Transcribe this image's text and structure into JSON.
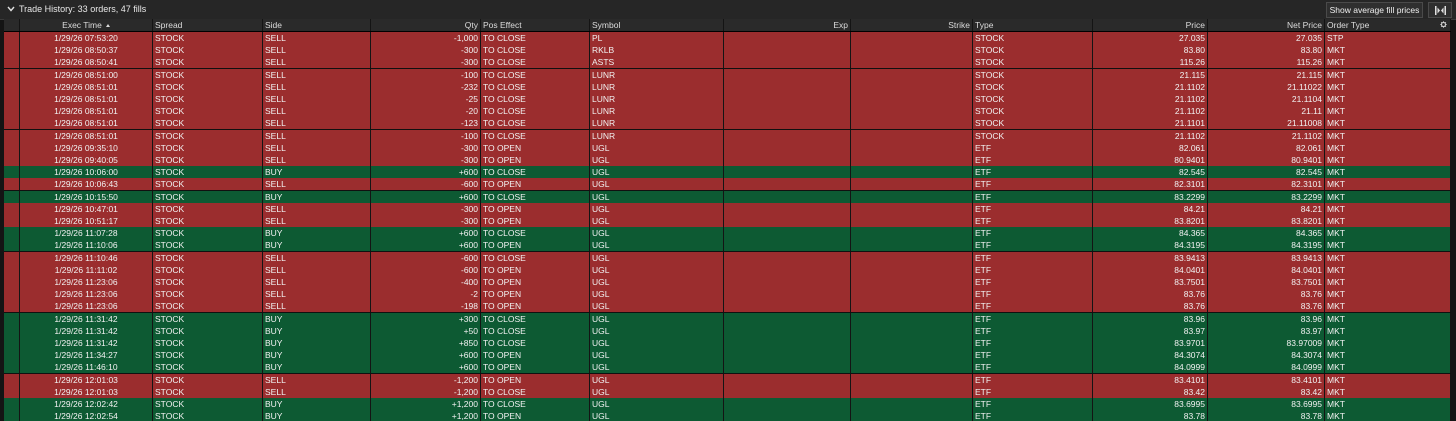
{
  "titlebar": {
    "title": "Trade History: 33 orders, 47 fills",
    "avg_button_label": "Show average fill prices"
  },
  "columns": [
    {
      "key": "exec_time",
      "label": "Exec Time",
      "align": "c",
      "sort": "asc"
    },
    {
      "key": "spread",
      "label": "Spread",
      "align": "l"
    },
    {
      "key": "side",
      "label": "Side",
      "align": "l"
    },
    {
      "key": "qty",
      "label": "Qty",
      "align": "r"
    },
    {
      "key": "pos_effect",
      "label": "Pos Effect",
      "align": "l"
    },
    {
      "key": "symbol",
      "label": "Symbol",
      "align": "l"
    },
    {
      "key": "exp",
      "label": "Exp",
      "align": "r"
    },
    {
      "key": "strike",
      "label": "Strike",
      "align": "r"
    },
    {
      "key": "type",
      "label": "Type",
      "align": "l"
    },
    {
      "key": "price",
      "label": "Price",
      "align": "r"
    },
    {
      "key": "net_price",
      "label": "Net Price",
      "align": "r"
    },
    {
      "key": "order_type",
      "label": "Order Type",
      "align": "l"
    }
  ],
  "rows": [
    {
      "exec_time": "1/29/26 07:53:20",
      "spread": "STOCK",
      "side": "SELL",
      "qty": "-1,000",
      "pos_effect": "TO CLOSE",
      "symbol": "PL",
      "exp": "",
      "strike": "",
      "type": "STOCK",
      "price": "27.035",
      "net_price": "27.035",
      "order_type": "STP"
    },
    {
      "exec_time": "1/29/26 08:50:37",
      "spread": "STOCK",
      "side": "SELL",
      "qty": "-300",
      "pos_effect": "TO CLOSE",
      "symbol": "RKLB",
      "exp": "",
      "strike": "",
      "type": "STOCK",
      "price": "83.80",
      "net_price": "83.80",
      "order_type": "MKT"
    },
    {
      "exec_time": "1/29/26 08:50:41",
      "spread": "STOCK",
      "side": "SELL",
      "qty": "-300",
      "pos_effect": "TO CLOSE",
      "symbol": "ASTS",
      "exp": "",
      "strike": "",
      "type": "STOCK",
      "price": "115.26",
      "net_price": "115.26",
      "order_type": "MKT"
    },
    {
      "exec_time": "1/29/26 08:51:00",
      "spread": "STOCK",
      "side": "SELL",
      "qty": "-100",
      "pos_effect": "TO CLOSE",
      "symbol": "LUNR",
      "exp": "",
      "strike": "",
      "type": "STOCK",
      "price": "21.115",
      "net_price": "21.115",
      "order_type": "MKT"
    },
    {
      "exec_time": "1/29/26 08:51:01",
      "spread": "STOCK",
      "side": "SELL",
      "qty": "-232",
      "pos_effect": "TO CLOSE",
      "symbol": "LUNR",
      "exp": "",
      "strike": "",
      "type": "STOCK",
      "price": "21.1102",
      "net_price": "21.11022",
      "order_type": "MKT"
    },
    {
      "exec_time": "1/29/26 08:51:01",
      "spread": "STOCK",
      "side": "SELL",
      "qty": "-25",
      "pos_effect": "TO CLOSE",
      "symbol": "LUNR",
      "exp": "",
      "strike": "",
      "type": "STOCK",
      "price": "21.1102",
      "net_price": "21.1104",
      "order_type": "MKT"
    },
    {
      "exec_time": "1/29/26 08:51:01",
      "spread": "STOCK",
      "side": "SELL",
      "qty": "-20",
      "pos_effect": "TO CLOSE",
      "symbol": "LUNR",
      "exp": "",
      "strike": "",
      "type": "STOCK",
      "price": "21.1102",
      "net_price": "21.11",
      "order_type": "MKT"
    },
    {
      "exec_time": "1/29/26 08:51:01",
      "spread": "STOCK",
      "side": "SELL",
      "qty": "-123",
      "pos_effect": "TO CLOSE",
      "symbol": "LUNR",
      "exp": "",
      "strike": "",
      "type": "STOCK",
      "price": "21.1101",
      "net_price": "21.11008",
      "order_type": "MKT"
    },
    {
      "exec_time": "1/29/26 08:51:01",
      "spread": "STOCK",
      "side": "SELL",
      "qty": "-100",
      "pos_effect": "TO CLOSE",
      "symbol": "LUNR",
      "exp": "",
      "strike": "",
      "type": "STOCK",
      "price": "21.1102",
      "net_price": "21.1102",
      "order_type": "MKT"
    },
    {
      "exec_time": "1/29/26 09:35:10",
      "spread": "STOCK",
      "side": "SELL",
      "qty": "-300",
      "pos_effect": "TO OPEN",
      "symbol": "UGL",
      "exp": "",
      "strike": "",
      "type": "ETF",
      "price": "82.061",
      "net_price": "82.061",
      "order_type": "MKT"
    },
    {
      "exec_time": "1/29/26 09:40:05",
      "spread": "STOCK",
      "side": "SELL",
      "qty": "-300",
      "pos_effect": "TO OPEN",
      "symbol": "UGL",
      "exp": "",
      "strike": "",
      "type": "ETF",
      "price": "80.9401",
      "net_price": "80.9401",
      "order_type": "MKT"
    },
    {
      "exec_time": "1/29/26 10:06:00",
      "spread": "STOCK",
      "side": "BUY",
      "qty": "+600",
      "pos_effect": "TO CLOSE",
      "symbol": "UGL",
      "exp": "",
      "strike": "",
      "type": "ETF",
      "price": "82.545",
      "net_price": "82.545",
      "order_type": "MKT"
    },
    {
      "exec_time": "1/29/26 10:06:43",
      "spread": "STOCK",
      "side": "SELL",
      "qty": "-600",
      "pos_effect": "TO OPEN",
      "symbol": "UGL",
      "exp": "",
      "strike": "",
      "type": "ETF",
      "price": "82.3101",
      "net_price": "82.3101",
      "order_type": "MKT"
    },
    {
      "exec_time": "1/29/26 10:15:50",
      "spread": "STOCK",
      "side": "BUY",
      "qty": "+600",
      "pos_effect": "TO CLOSE",
      "symbol": "UGL",
      "exp": "",
      "strike": "",
      "type": "ETF",
      "price": "83.2299",
      "net_price": "83.2299",
      "order_type": "MKT"
    },
    {
      "exec_time": "1/29/26 10:47:01",
      "spread": "STOCK",
      "side": "SELL",
      "qty": "-300",
      "pos_effect": "TO OPEN",
      "symbol": "UGL",
      "exp": "",
      "strike": "",
      "type": "ETF",
      "price": "84.21",
      "net_price": "84.21",
      "order_type": "MKT"
    },
    {
      "exec_time": "1/29/26 10:51:17",
      "spread": "STOCK",
      "side": "SELL",
      "qty": "-300",
      "pos_effect": "TO OPEN",
      "symbol": "UGL",
      "exp": "",
      "strike": "",
      "type": "ETF",
      "price": "83.8201",
      "net_price": "83.8201",
      "order_type": "MKT"
    },
    {
      "exec_time": "1/29/26 11:07:28",
      "spread": "STOCK",
      "side": "BUY",
      "qty": "+600",
      "pos_effect": "TO CLOSE",
      "symbol": "UGL",
      "exp": "",
      "strike": "",
      "type": "ETF",
      "price": "84.365",
      "net_price": "84.365",
      "order_type": "MKT"
    },
    {
      "exec_time": "1/29/26 11:10:06",
      "spread": "STOCK",
      "side": "BUY",
      "qty": "+600",
      "pos_effect": "TO OPEN",
      "symbol": "UGL",
      "exp": "",
      "strike": "",
      "type": "ETF",
      "price": "84.3195",
      "net_price": "84.3195",
      "order_type": "MKT"
    },
    {
      "exec_time": "1/29/26 11:10:46",
      "spread": "STOCK",
      "side": "SELL",
      "qty": "-600",
      "pos_effect": "TO CLOSE",
      "symbol": "UGL",
      "exp": "",
      "strike": "",
      "type": "ETF",
      "price": "83.9413",
      "net_price": "83.9413",
      "order_type": "MKT"
    },
    {
      "exec_time": "1/29/26 11:11:02",
      "spread": "STOCK",
      "side": "SELL",
      "qty": "-600",
      "pos_effect": "TO OPEN",
      "symbol": "UGL",
      "exp": "",
      "strike": "",
      "type": "ETF",
      "price": "84.0401",
      "net_price": "84.0401",
      "order_type": "MKT"
    },
    {
      "exec_time": "1/29/26 11:23:06",
      "spread": "STOCK",
      "side": "SELL",
      "qty": "-400",
      "pos_effect": "TO OPEN",
      "symbol": "UGL",
      "exp": "",
      "strike": "",
      "type": "ETF",
      "price": "83.7501",
      "net_price": "83.7501",
      "order_type": "MKT"
    },
    {
      "exec_time": "1/29/26 11:23:06",
      "spread": "STOCK",
      "side": "SELL",
      "qty": "-2",
      "pos_effect": "TO OPEN",
      "symbol": "UGL",
      "exp": "",
      "strike": "",
      "type": "ETF",
      "price": "83.76",
      "net_price": "83.76",
      "order_type": "MKT"
    },
    {
      "exec_time": "1/29/26 11:23:06",
      "spread": "STOCK",
      "side": "SELL",
      "qty": "-198",
      "pos_effect": "TO OPEN",
      "symbol": "UGL",
      "exp": "",
      "strike": "",
      "type": "ETF",
      "price": "83.76",
      "net_price": "83.76",
      "order_type": "MKT"
    },
    {
      "exec_time": "1/29/26 11:31:42",
      "spread": "STOCK",
      "side": "BUY",
      "qty": "+300",
      "pos_effect": "TO CLOSE",
      "symbol": "UGL",
      "exp": "",
      "strike": "",
      "type": "ETF",
      "price": "83.96",
      "net_price": "83.96",
      "order_type": "MKT"
    },
    {
      "exec_time": "1/29/26 11:31:42",
      "spread": "STOCK",
      "side": "BUY",
      "qty": "+50",
      "pos_effect": "TO CLOSE",
      "symbol": "UGL",
      "exp": "",
      "strike": "",
      "type": "ETF",
      "price": "83.97",
      "net_price": "83.97",
      "order_type": "MKT"
    },
    {
      "exec_time": "1/29/26 11:31:42",
      "spread": "STOCK",
      "side": "BUY",
      "qty": "+850",
      "pos_effect": "TO CLOSE",
      "symbol": "UGL",
      "exp": "",
      "strike": "",
      "type": "ETF",
      "price": "83.9701",
      "net_price": "83.97009",
      "order_type": "MKT"
    },
    {
      "exec_time": "1/29/26 11:34:27",
      "spread": "STOCK",
      "side": "BUY",
      "qty": "+600",
      "pos_effect": "TO OPEN",
      "symbol": "UGL",
      "exp": "",
      "strike": "",
      "type": "ETF",
      "price": "84.3074",
      "net_price": "84.3074",
      "order_type": "MKT"
    },
    {
      "exec_time": "1/29/26 11:46:10",
      "spread": "STOCK",
      "side": "BUY",
      "qty": "+600",
      "pos_effect": "TO OPEN",
      "symbol": "UGL",
      "exp": "",
      "strike": "",
      "type": "ETF",
      "price": "84.0999",
      "net_price": "84.0999",
      "order_type": "MKT"
    },
    {
      "exec_time": "1/29/26 12:01:03",
      "spread": "STOCK",
      "side": "SELL",
      "qty": "-1,200",
      "pos_effect": "TO OPEN",
      "symbol": "UGL",
      "exp": "",
      "strike": "",
      "type": "ETF",
      "price": "83.4101",
      "net_price": "83.4101",
      "order_type": "MKT"
    },
    {
      "exec_time": "1/29/26 12:01:03",
      "spread": "STOCK",
      "side": "SELL",
      "qty": "-1,200",
      "pos_effect": "TO CLOSE",
      "symbol": "UGL",
      "exp": "",
      "strike": "",
      "type": "ETF",
      "price": "83.42",
      "net_price": "83.42",
      "order_type": "MKT"
    },
    {
      "exec_time": "1/29/26 12:02:42",
      "spread": "STOCK",
      "side": "BUY",
      "qty": "+1,200",
      "pos_effect": "TO CLOSE",
      "symbol": "UGL",
      "exp": "",
      "strike": "",
      "type": "ETF",
      "price": "83.6995",
      "net_price": "83.6995",
      "order_type": "MKT"
    },
    {
      "exec_time": "1/29/26 12:02:54",
      "spread": "STOCK",
      "side": "BUY",
      "qty": "+1,200",
      "pos_effect": "TO OPEN",
      "symbol": "UGL",
      "exp": "",
      "strike": "",
      "type": "ETF",
      "price": "83.78",
      "net_price": "83.78",
      "order_type": "MKT"
    }
  ],
  "colors": {
    "sell_row": "#9b2d2e",
    "buy_row": "#0d5a33",
    "header_bg": "#2a2a2a",
    "panel_bg": "#1b1b1b"
  },
  "icons": {
    "collapse": "chevron-down-icon",
    "collapse_columns": "collapse-columns-icon",
    "settings": "gear-icon",
    "sort": "sort-ascending-icon"
  }
}
